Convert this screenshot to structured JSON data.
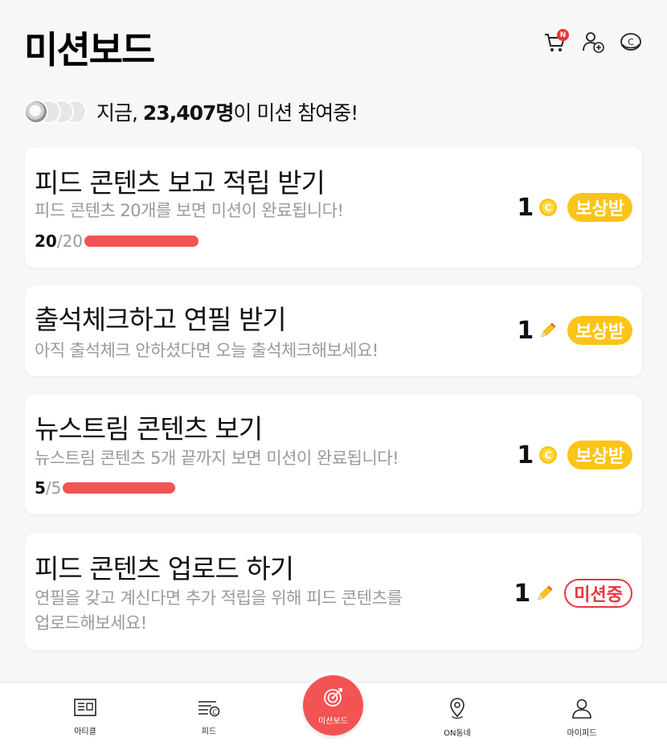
{
  "header": {
    "title": "미션보드",
    "cart_badge": "N",
    "icons": [
      "cart-icon",
      "add-friend-icon",
      "coin-icon"
    ]
  },
  "participants": {
    "prefix": "지금, ",
    "count": "23,407명",
    "suffix": "이 미션 참여중!"
  },
  "missions": [
    {
      "title": "피드 콘텐츠 보고 적립 받기",
      "description": "피드 콘텐츠 20개를 보면 미션이 완료됩니다!",
      "progress_current": "20",
      "progress_total": "/20",
      "progress_fraction": 1.0,
      "reward_amount": "1",
      "reward_icon": "coin-icon",
      "status": "보상받"
    },
    {
      "title": "출석체크하고 연필 받기",
      "description": "아직 출석체크 안하셨다면 오늘 출석체크해보세요!",
      "reward_amount": "1",
      "reward_icon": "pencil-icon",
      "status": "보상받"
    },
    {
      "title": "뉴스트림 콘텐츠 보기",
      "description": "뉴스트림 콘텐츠 5개 끝까지 보면 미션이 완료됩니다!",
      "progress_current": "5",
      "progress_total": "/5",
      "progress_fraction": 1.0,
      "reward_amount": "1",
      "reward_icon": "coin-icon",
      "status": "보상받"
    },
    {
      "title": "피드 콘텐츠 업로드 하기",
      "description_line1": "연필을 갖고 계신다면 추가 적립을 위해 피드 콘텐츠를",
      "description_line2": "업로드해보세요!",
      "reward_amount": "1",
      "reward_icon": "pencil-icon",
      "status": "미션중"
    }
  ],
  "nav": {
    "items": [
      {
        "label": "아티클",
        "icon": "article-icon"
      },
      {
        "label": "피드",
        "icon": "feed-icon"
      },
      {
        "label": "미션보드",
        "icon": "target-icon",
        "active": true
      },
      {
        "label": "ON동네",
        "icon": "location-pin-icon"
      },
      {
        "label": "마이피드",
        "icon": "person-icon"
      }
    ]
  },
  "colors": {
    "accent_red": "#f25353",
    "badge_yellow": "#fcc419",
    "text_gray": "#9a9a9a"
  }
}
